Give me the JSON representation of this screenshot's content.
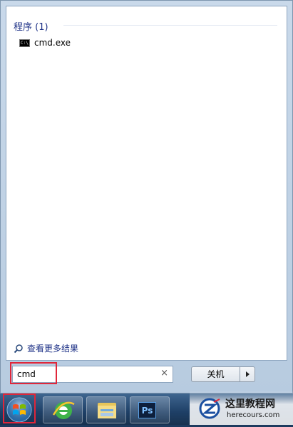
{
  "results": {
    "group_header": "程序 (1)",
    "items": [
      {
        "label": "cmd.exe",
        "icon": "cmd-window-icon",
        "icon_text": "C:\\"
      }
    ],
    "see_more": "查看更多结果"
  },
  "search": {
    "value": "cmd",
    "clear_glyph": "×"
  },
  "shutdown": {
    "label": "关机"
  },
  "taskbar": {
    "pinned": [
      {
        "name": "internet-explorer",
        "icon": "ie-icon"
      },
      {
        "name": "windows-explorer",
        "icon": "folder-icon"
      },
      {
        "name": "photoshop",
        "icon": "photoshop-icon",
        "text": "Ps"
      }
    ]
  },
  "watermark": {
    "title": "这里教程网",
    "url": "herecours.com"
  },
  "colors": {
    "highlight": "#e0263a",
    "link": "#1e3287",
    "taskbar": "#1e3f66"
  }
}
